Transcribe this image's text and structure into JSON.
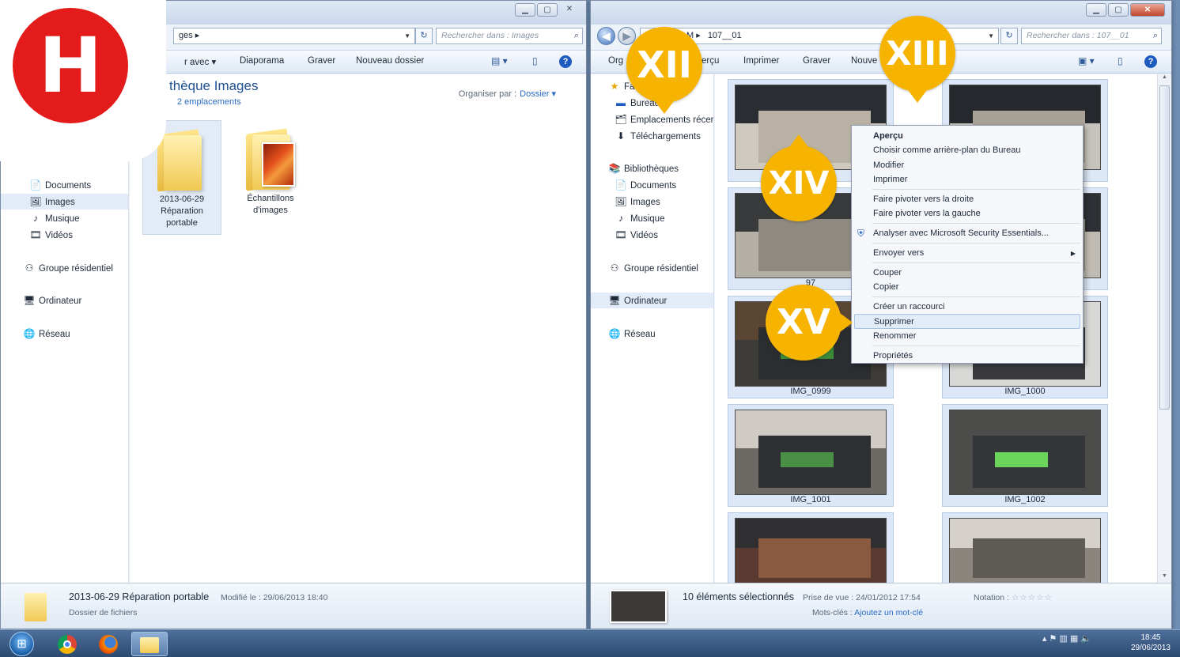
{
  "left_window": {
    "address": "ges ▸",
    "search_placeholder": "Rechercher dans : Images",
    "toolbar": [
      "r avec ▾",
      "Diaporama",
      "Graver",
      "Nouveau dossier"
    ],
    "library_title": "thèque Images",
    "library_sub": "2 emplacements",
    "organize_label": "Organiser par :",
    "organize_value": "Dossier ▾",
    "nav": [
      {
        "label": "Documents",
        "icon": "documents-icon",
        "selected": false
      },
      {
        "label": "Images",
        "icon": "images-icon",
        "selected": true
      },
      {
        "label": "Musique",
        "icon": "music-icon",
        "selected": false
      },
      {
        "label": "Vidéos",
        "icon": "videos-icon",
        "selected": false
      },
      {
        "label": "Groupe résidentiel",
        "icon": "homegroup-icon",
        "selected": false
      },
      {
        "label": "Ordinateur",
        "icon": "computer-icon",
        "selected": false
      },
      {
        "label": "Réseau",
        "icon": "network-icon",
        "selected": false
      }
    ],
    "folders": [
      {
        "line1": "2013-06-29",
        "line2": "Réparation",
        "line3": "portable",
        "selected": true
      },
      {
        "line1": "Échantillons",
        "line2": "d'images",
        "line3": "",
        "selected": false
      }
    ],
    "details": {
      "name": "2013-06-29 Réparation portable",
      "modified": "Modifié le : 29/06/2013 18:40",
      "type": "Dossier de fichiers"
    }
  },
  "right_window": {
    "address_prefix": "M ▸",
    "address_folder": "107__01",
    "search_placeholder": "Rechercher dans : 107__01",
    "toolbar": [
      "Org",
      "erçu",
      "Imprimer",
      "Graver",
      "Nouve"
    ],
    "nav": [
      {
        "label": "Fa",
        "icon": "favorites-star-icon"
      },
      {
        "label": "Bureau",
        "icon": "desktop-icon"
      },
      {
        "label": "Emplacements récen",
        "icon": "recent-places-icon"
      },
      {
        "label": "Téléchargements",
        "icon": "downloads-icon"
      },
      {
        "label": "Bibliothèques",
        "icon": "libraries-icon"
      },
      {
        "label": "Documents",
        "icon": "documents-icon"
      },
      {
        "label": "Images",
        "icon": "images-icon"
      },
      {
        "label": "Musique",
        "icon": "music-icon"
      },
      {
        "label": "Vidéos",
        "icon": "videos-icon"
      },
      {
        "label": "Groupe résidentiel",
        "icon": "homegroup-icon"
      },
      {
        "label": "Ordinateur",
        "icon": "computer-icon"
      },
      {
        "label": "Réseau",
        "icon": "network-icon"
      }
    ],
    "thumbnails": [
      {
        "label": ""
      },
      {
        "label": ""
      },
      {
        "label": "97"
      },
      {
        "label": ""
      },
      {
        "label": "IMG_0999"
      },
      {
        "label": "IMG_1000"
      },
      {
        "label": "IMG_1001"
      },
      {
        "label": "IMG_1002"
      },
      {
        "label": ""
      },
      {
        "label": ""
      }
    ],
    "details": {
      "count": "10 éléments sélectionnés",
      "taken": "Prise de vue : 24/01/2012 17:54",
      "keywords_label": "Mots-clés :",
      "keywords_link": "Ajoutez un mot-clé",
      "rating_label": "Notation :",
      "stars": "☆☆☆☆☆"
    }
  },
  "context_menu": {
    "items": [
      {
        "label": "Aperçu",
        "bold": true
      },
      {
        "label": "Choisir comme arrière-plan du Bureau"
      },
      {
        "label": "Modifier"
      },
      {
        "label": "Imprimer"
      },
      {
        "label": "Faire pivoter vers la droite"
      },
      {
        "label": "Faire pivoter vers la gauche"
      },
      {
        "label": "Analyser avec Microsoft Security Essentials..."
      },
      {
        "label": "Envoyer vers"
      },
      {
        "label": "Couper"
      },
      {
        "label": "Copier"
      },
      {
        "label": "Créer un raccourci"
      },
      {
        "label": "Supprimer",
        "hover": true
      },
      {
        "label": "Renommer"
      },
      {
        "label": "Propriétés"
      }
    ]
  },
  "markers": [
    "XII",
    "XIII",
    "XIV",
    "XV"
  ],
  "badge": "H",
  "taskbar": {
    "apps": [
      "start-orb-icon",
      "chrome-icon",
      "firefox-icon",
      "explorer-icon"
    ],
    "time": "18:45",
    "date": "29/06/2013"
  },
  "colors": {
    "accent": "#f6b400",
    "badge": "#e31b1b",
    "link": "#2a6bc6"
  }
}
